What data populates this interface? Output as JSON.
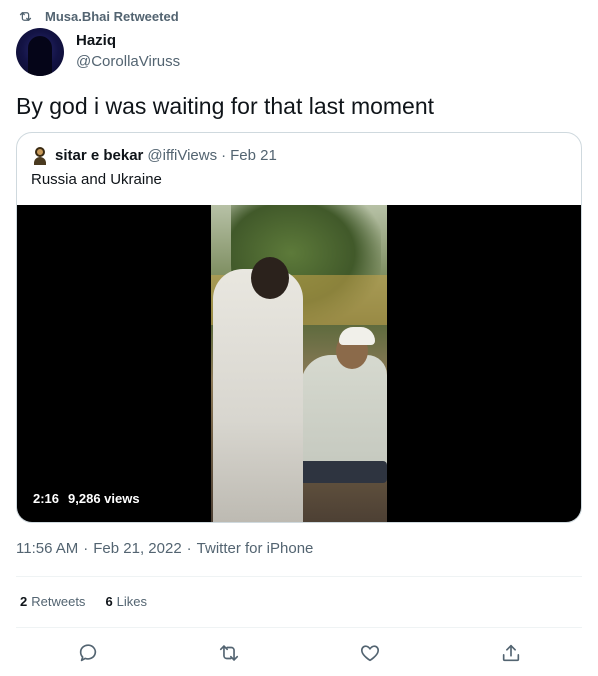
{
  "retweet_context": {
    "label": "Musa.Bhai Retweeted",
    "icon": "retweet-icon"
  },
  "author": {
    "name": "Haziq",
    "handle": "@CorollaViruss",
    "avatar": "user-avatar"
  },
  "tweet": {
    "text": "By god i was waiting for that last moment"
  },
  "quoted_tweet": {
    "author_name": "sitar e bekar",
    "author_handle": "@iffiViews",
    "separator": "·",
    "date": "Feb 21",
    "text": "Russia and Ukraine",
    "video": {
      "duration": "2:16",
      "views": "9,286 views"
    }
  },
  "meta": {
    "time": "11:56 AM",
    "separator": "·",
    "date": "Feb 21, 2022",
    "source": "Twitter for iPhone"
  },
  "stats": {
    "retweets_count": "2",
    "retweets_label": "Retweets",
    "likes_count": "6",
    "likes_label": "Likes"
  },
  "actions": [
    "reply-icon",
    "retweet-icon",
    "like-icon",
    "share-icon"
  ],
  "colors": {
    "text_primary": "#0f1419",
    "text_secondary": "#536471",
    "border": "#cfd9de",
    "divider": "#eff3f4"
  }
}
